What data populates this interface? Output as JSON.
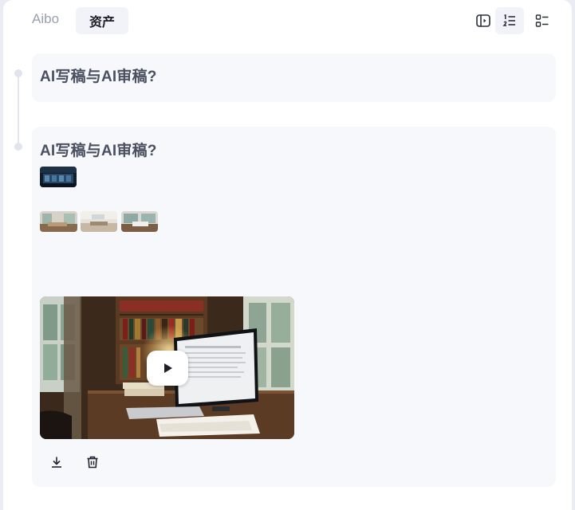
{
  "header": {
    "tabs": [
      {
        "label": "Aibo",
        "active": false
      },
      {
        "label": "资产",
        "active": true
      }
    ],
    "buttons": [
      {
        "icon": "sidebar-toggle-icon",
        "active": false
      },
      {
        "icon": "ordered-list-icon",
        "active": true
      },
      {
        "icon": "checklist-icon",
        "active": false
      }
    ]
  },
  "entries": [
    {
      "title": "AI写稿与AI审稿?"
    },
    {
      "title": "AI写稿与AI审稿?",
      "actions": [
        {
          "icon": "download-icon"
        },
        {
          "icon": "trash-icon"
        }
      ]
    }
  ],
  "colors": {
    "card_bg": "#f7f8fc",
    "title": "#4a5060",
    "tab_active_bg": "#f1f3f8",
    "muted_tab": "#9aa0ad"
  }
}
